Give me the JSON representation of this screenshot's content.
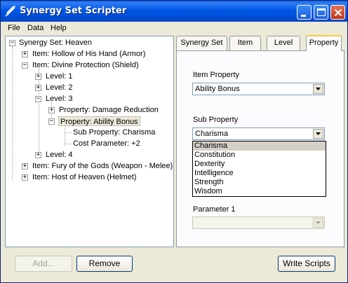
{
  "window": {
    "title": "Synergy Set Scripter",
    "icon": "quill-icon"
  },
  "menu": [
    "File",
    "Data",
    "Help"
  ],
  "tree": {
    "root": "Synergy Set: Heaven",
    "item1": "Item: Hollow of His Hand (Armor)",
    "item2": "Item: Divine Protection (Shield)",
    "level1": "Level: 1",
    "level2": "Level: 2",
    "level3": "Level: 3",
    "prop_dr": "Property: Damage Reduction",
    "prop_ab": "Property: Ability Bonus",
    "sub_prop": "Sub Property: Charisma",
    "cost": "Cost Parameter: +2",
    "level4": "Level: 4",
    "item3": "Item: Fury of the Gods (Weapon - Melee)",
    "item4": "Item: Host of Heaven (Helmet)"
  },
  "tabs": [
    "Synergy Set",
    "Item",
    "Level",
    "Property"
  ],
  "active_tab": "Property",
  "property_panel": {
    "item_property_label": "Item Property",
    "item_property_value": "Ability Bonus",
    "sub_property_label": "Sub Property",
    "sub_property_value": "Charisma",
    "sub_property_options": [
      "Charisma",
      "Constitution",
      "Dexterity",
      "Intelligence",
      "Strength",
      "Wisdom"
    ],
    "parameter1_label": "Parameter 1",
    "parameter1_value": ""
  },
  "buttons": {
    "add": "Add...",
    "remove": "Remove",
    "write_scripts": "Write Scripts"
  }
}
